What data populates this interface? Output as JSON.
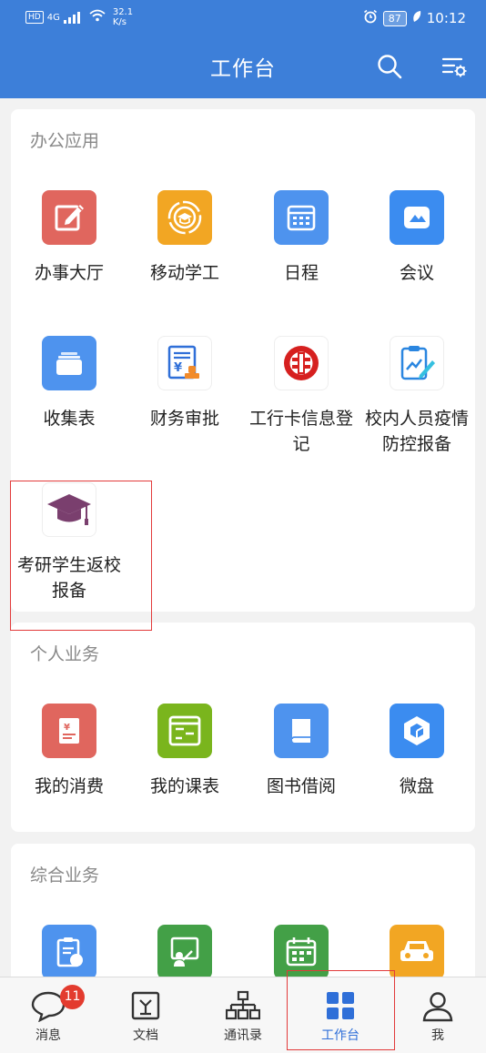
{
  "status_bar": {
    "network_tag": "HD",
    "signal_type": "4G",
    "speed_value": "32.1",
    "speed_unit": "K/s",
    "battery": "87",
    "time": "10:12"
  },
  "header": {
    "title": "工作台",
    "icons": [
      "search-icon",
      "settings-list-icon"
    ]
  },
  "sections": [
    {
      "title": "办公应用",
      "apps": [
        {
          "label": "办事大厅",
          "icon": "edit-icon",
          "color": "#e0665e"
        },
        {
          "label": "移动学工",
          "icon": "graduation-badge-icon",
          "color": "#f2a623"
        },
        {
          "label": "日程",
          "icon": "calendar-icon",
          "color": "#4e93ee"
        },
        {
          "label": "会议",
          "icon": "meeting-icon",
          "color": "#3b8cf0"
        },
        {
          "label": "收集表",
          "icon": "folder-icon",
          "color": "#4e93ee"
        },
        {
          "label": "财务审批",
          "icon": "finance-document-icon",
          "color": "#ffffff"
        },
        {
          "label": "工行卡信息登记",
          "icon": "icbc-logo-icon",
          "color": "#ffffff"
        },
        {
          "label": "校内人员疫情防控报备",
          "icon": "clipboard-chart-icon",
          "color": "#ffffff"
        },
        {
          "label": "考研学生返校报备",
          "icon": "graduation-cap-icon",
          "color": "#ffffff"
        }
      ]
    },
    {
      "title": "个人业务",
      "apps": [
        {
          "label": "我的消费",
          "icon": "receipt-icon",
          "color": "#e0665e"
        },
        {
          "label": "我的课表",
          "icon": "timetable-icon",
          "color": "#7ab51d"
        },
        {
          "label": "图书借阅",
          "icon": "book-icon",
          "color": "#4e93ee"
        },
        {
          "label": "微盘",
          "icon": "cloud-drive-icon",
          "color": "#3b8cf0"
        }
      ]
    },
    {
      "title": "综合业务",
      "apps": [
        {
          "label": "",
          "icon": "clipboard-book-icon",
          "color": "#4e93ee"
        },
        {
          "label": "",
          "icon": "teacher-board-icon",
          "color": "#43a047"
        },
        {
          "label": "",
          "icon": "calendar-grid-icon",
          "color": "#43a047"
        },
        {
          "label": "",
          "icon": "car-icon",
          "color": "#f2a623"
        }
      ]
    }
  ],
  "bottom_nav": [
    {
      "label": "消息",
      "icon": "chat-bubble-icon",
      "badge": "11"
    },
    {
      "label": "文档",
      "icon": "document-icon"
    },
    {
      "label": "通讯录",
      "icon": "org-chart-icon"
    },
    {
      "label": "工作台",
      "icon": "grid-icon",
      "active": true
    },
    {
      "label": "我",
      "icon": "person-icon"
    }
  ],
  "colors": {
    "header": "#3d7fd9",
    "accent": "#2f6fd8",
    "highlight_box": "#e23a3a",
    "badge": "#e33b2e"
  }
}
